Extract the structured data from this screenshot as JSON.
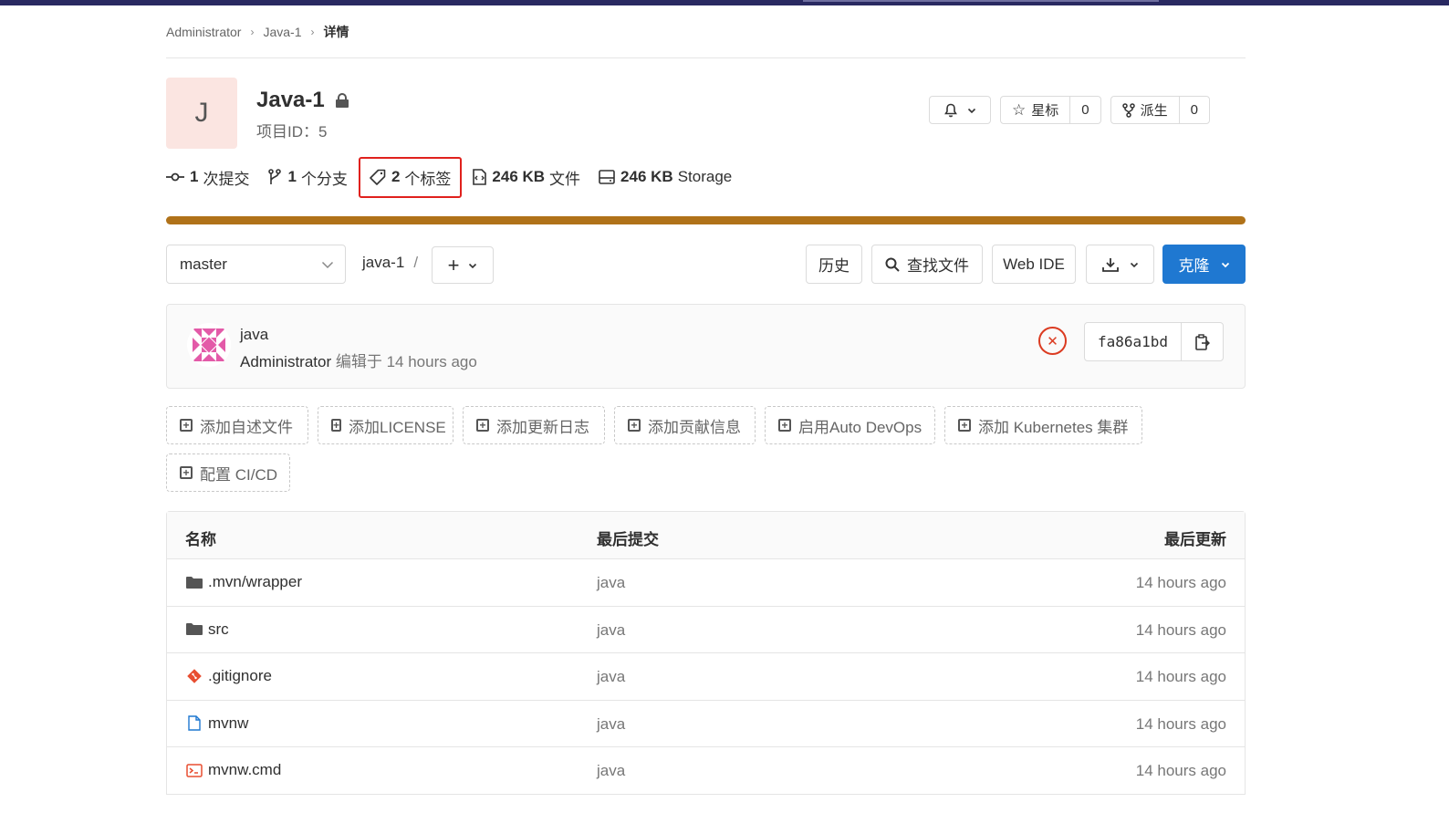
{
  "breadcrumb": {
    "items": [
      "Administrator",
      "Java-1"
    ],
    "current": "详情"
  },
  "project": {
    "avatar_letter": "J",
    "name": "Java-1",
    "id_label": "项目ID：5",
    "star_label": "星标",
    "star_count": "0",
    "fork_label": "派生",
    "fork_count": "0"
  },
  "stats": {
    "commits_num": "1",
    "commits_label": "次提交",
    "branches_num": "1",
    "branches_label": "个分支",
    "tags_num": "2",
    "tags_label": "个标签",
    "files_num": "246 KB",
    "files_label": "文件",
    "storage_num": "246 KB",
    "storage_label": "Storage"
  },
  "language_bar_color": "#b07219",
  "toolbar": {
    "branch": "master",
    "path": "java-1",
    "path_sep": "/",
    "history": "历史",
    "find_file": "查找文件",
    "web_ide": "Web IDE",
    "clone": "克隆"
  },
  "commit": {
    "title": "java",
    "author": "Administrator",
    "meta": "编辑于 14 hours ago",
    "sha": "fa86a1bd",
    "status_color": "#db3b21"
  },
  "quick_actions": [
    "添加自述文件",
    "添加LICENSE",
    "添加更新日志",
    "添加贡献信息",
    "启用Auto DevOps",
    "添加 Kubernetes 集群",
    "配置 CI/CD"
  ],
  "table": {
    "headers": {
      "name": "名称",
      "last_commit": "最后提交",
      "last_update": "最后更新"
    },
    "rows": [
      {
        "name": ".mvn/wrapper",
        "icon": "folder-icon",
        "commit": "java",
        "time": "14 hours ago"
      },
      {
        "name": "src",
        "icon": "folder-icon",
        "commit": "java",
        "time": "14 hours ago"
      },
      {
        "name": ".gitignore",
        "icon": "git-icon",
        "commit": "java",
        "time": "14 hours ago"
      },
      {
        "name": "mvnw",
        "icon": "file-icon",
        "commit": "java",
        "time": "14 hours ago"
      },
      {
        "name": "mvnw.cmd",
        "icon": "terminal-icon",
        "commit": "java",
        "time": "14 hours ago"
      }
    ]
  }
}
